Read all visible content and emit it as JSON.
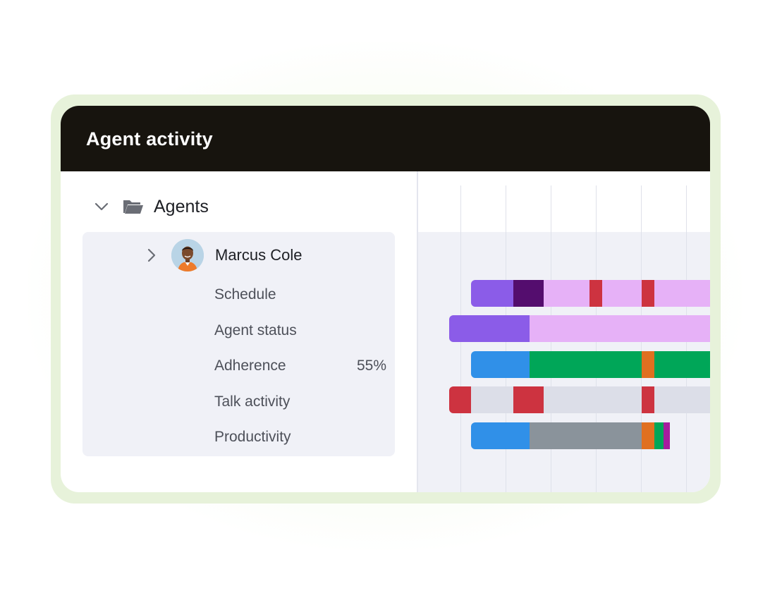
{
  "panel": {
    "title": "Agent activity"
  },
  "tree": {
    "group_label": "Agents",
    "agent": {
      "name": "Marcus Cole",
      "metrics": [
        {
          "label": "Schedule",
          "value": ""
        },
        {
          "label": "Agent status",
          "value": ""
        },
        {
          "label": "Adherence",
          "value": "55%"
        },
        {
          "label": "Talk activity",
          "value": ""
        },
        {
          "label": "Productivity",
          "value": ""
        }
      ]
    }
  },
  "colors": {
    "header_bg": "#17140e",
    "panel_bg": "#f0f1f7",
    "violet": "#8b5ce8",
    "dark_purple": "#540d6e",
    "pink": "#e6b1f7",
    "red": "#cd3340",
    "blue": "#3090e8",
    "green": "#00a658",
    "orange": "#e07020",
    "gray": "#8a939b",
    "light_gray": "#dcdee8",
    "magenta": "#a61d9e"
  },
  "timeline": {
    "rows": [
      {
        "name": "schedule",
        "segments": [
          {
            "start": 0.0,
            "end": 0.176,
            "color": "violet"
          },
          {
            "start": 0.176,
            "end": 0.304,
            "color": "dark_purple"
          },
          {
            "start": 0.304,
            "end": 0.493,
            "color": "pink"
          },
          {
            "start": 0.493,
            "end": 0.547,
            "color": "red"
          },
          {
            "start": 0.547,
            "end": 0.713,
            "color": "pink"
          },
          {
            "start": 0.713,
            "end": 0.766,
            "color": "red"
          },
          {
            "start": 0.766,
            "end": 1.0,
            "color": "pink"
          }
        ]
      },
      {
        "name": "agent-status",
        "segments": [
          {
            "start": -0.09,
            "end": 0.245,
            "color": "violet"
          },
          {
            "start": 0.245,
            "end": 1.0,
            "color": "pink"
          }
        ]
      },
      {
        "name": "adherence",
        "segments": [
          {
            "start": 0.0,
            "end": 0.245,
            "color": "blue"
          },
          {
            "start": 0.245,
            "end": 0.713,
            "color": "green"
          },
          {
            "start": 0.713,
            "end": 0.766,
            "color": "orange"
          },
          {
            "start": 0.766,
            "end": 1.0,
            "color": "green"
          }
        ]
      },
      {
        "name": "talk-activity",
        "segments": [
          {
            "start": -0.09,
            "end": 0.0,
            "color": "red"
          },
          {
            "start": 0.0,
            "end": 0.176,
            "color": "light_gray"
          },
          {
            "start": 0.176,
            "end": 0.304,
            "color": "red"
          },
          {
            "start": 0.304,
            "end": 0.713,
            "color": "light_gray"
          },
          {
            "start": 0.713,
            "end": 0.766,
            "color": "red"
          },
          {
            "start": 0.766,
            "end": 1.0,
            "color": "light_gray"
          }
        ]
      },
      {
        "name": "productivity",
        "segments": [
          {
            "start": 0.0,
            "end": 0.245,
            "color": "blue"
          },
          {
            "start": 0.245,
            "end": 0.713,
            "color": "gray"
          },
          {
            "start": 0.713,
            "end": 0.766,
            "color": "orange"
          },
          {
            "start": 0.766,
            "end": 0.804,
            "color": "green"
          },
          {
            "start": 0.804,
            "end": 0.83,
            "color": "magenta"
          }
        ]
      }
    ]
  }
}
